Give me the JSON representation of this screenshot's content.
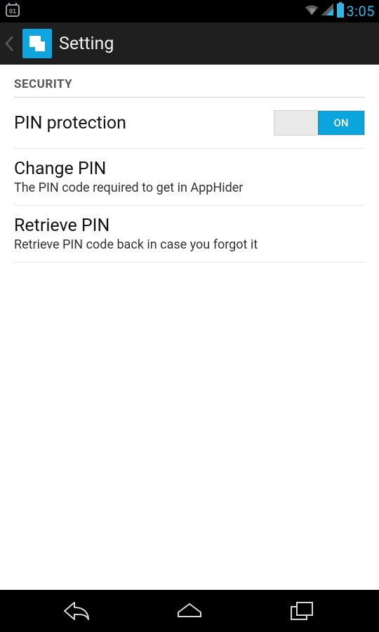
{
  "status_bar": {
    "notification_icon_label": "01",
    "time": "3:05"
  },
  "app_bar": {
    "title": "Setting"
  },
  "security": {
    "header": "SECURITY",
    "pin_protection": {
      "title": "PIN protection",
      "toggle_state": "ON"
    },
    "change_pin": {
      "title": "Change PIN",
      "subtitle": "The PIN code required to get in AppHider"
    },
    "retrieve_pin": {
      "title": "Retrieve PIN",
      "subtitle": "Retrieve PIN code back in case you forgot it"
    }
  }
}
